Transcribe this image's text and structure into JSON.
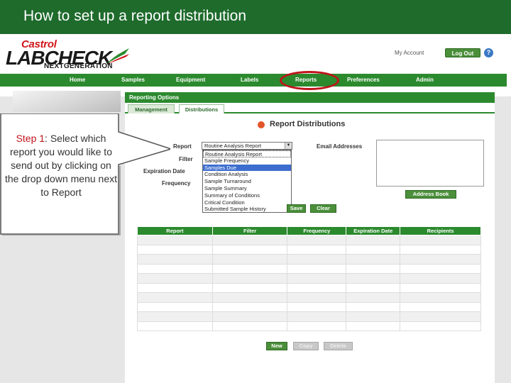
{
  "slide": {
    "title": "How to set up a report distribution"
  },
  "logo": {
    "brand": "Castrol",
    "main": "LABCHECK",
    "sub": "NEXTGENERATION"
  },
  "header": {
    "my_account": "My Account",
    "logout": "Log Out",
    "help": "?"
  },
  "nav": {
    "items": [
      "Home",
      "Samples",
      "Equipment",
      "Labels",
      "Reports",
      "Preferences",
      "Admin"
    ],
    "highlighted": "Reports"
  },
  "reporting": {
    "bar_title": "Reporting Options",
    "tabs": [
      "Management",
      "Distributions"
    ],
    "active_tab": "Distributions"
  },
  "form": {
    "title": "Report Distributions",
    "labels": {
      "report": "Report",
      "filter": "Filter",
      "expiration": "Expiration Date",
      "frequency": "Frequency",
      "email": "Email Addresses"
    },
    "report_value": "Routine Analysis Report",
    "dropdown_options": [
      "Routine Analysis Report",
      "Sample Frequency",
      "Samples Due",
      "Condition Analysis",
      "Sample Turnaround",
      "Sample Summary",
      "Summary of Conditions",
      "Critical Condition",
      "Submitted Sample History"
    ],
    "dropdown_selected": "Samples Due",
    "address_book": "Address Book",
    "save": "Save",
    "clear": "Clear"
  },
  "table": {
    "headers": [
      "Report",
      "Filter",
      "Frequency",
      "Expiration Date",
      "Recipients"
    ],
    "empty_rows": 10
  },
  "actions": {
    "new": "New",
    "copy": "Copy",
    "delete": "Delete"
  },
  "callout": {
    "step": "Step 1",
    "text": ": Select which report you would like to send out by clicking on the drop down menu next to Report"
  },
  "colors": {
    "title_bar": "#1e6b2c",
    "nav": "#2c8a2e",
    "highlight": "#c0141b",
    "selected": "#3d6ecf"
  }
}
